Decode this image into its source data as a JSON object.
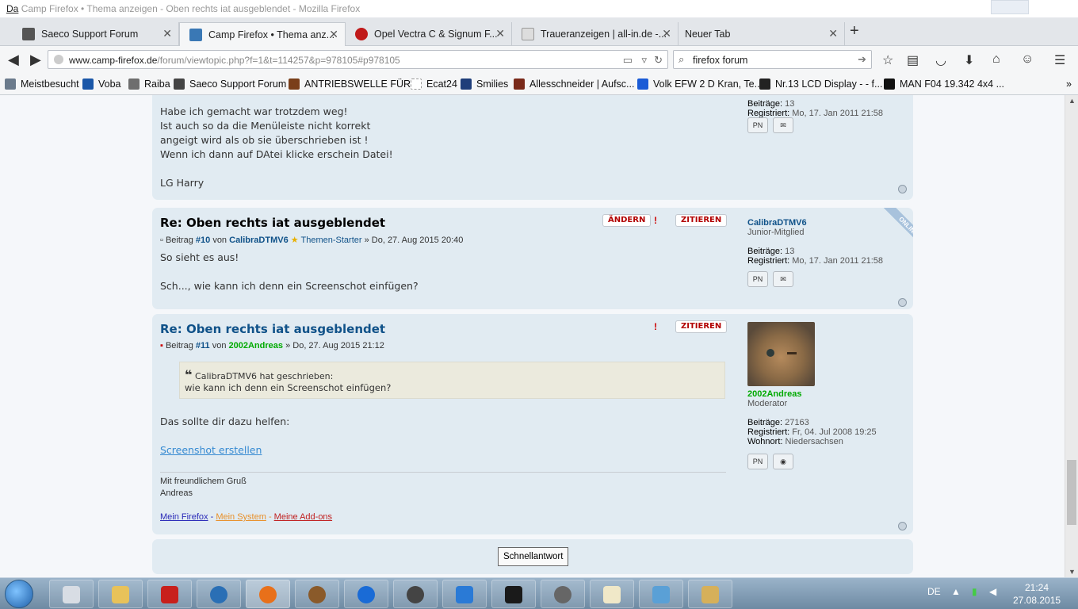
{
  "window": {
    "title_prefix": "Da",
    "title": "Camp Firefox • Thema anzeigen - Oben rechts iat ausgeblendet - Mozilla Firefox"
  },
  "tabs": [
    {
      "label": "Saeco Support Forum",
      "icon": "saeco-icon"
    },
    {
      "label": "Camp Firefox • Thema anz...",
      "icon": "camp-firefox-icon"
    },
    {
      "label": "Opel Vectra C & Signum F...",
      "icon": "opel-icon"
    },
    {
      "label": "Traueranzeigen | all-in.de -...",
      "icon": "allin-icon"
    },
    {
      "label": "Neuer Tab",
      "icon": ""
    }
  ],
  "newtab_label": "+",
  "nav": {
    "url_domain": "www.camp-firefox.de",
    "url_path": "/forum/viewtopic.php?f=1&t=114257&p=978105#p978105",
    "search_query": "firefox forum"
  },
  "bookmarks": [
    {
      "label": "Meistbesucht",
      "color": "#6b7b8c"
    },
    {
      "label": "Voba",
      "color": "#1a57a8"
    },
    {
      "label": "Raiba",
      "color": "#6e6e6e"
    },
    {
      "label": "Saeco Support Forum",
      "color": "#444"
    },
    {
      "label": "ANTRIEBSWELLE FÜR ...",
      "color": "#7a3f1a"
    },
    {
      "label": "Ecat24",
      "color": "#bbb"
    },
    {
      "label": "Smilies",
      "color": "#1f3e7a"
    },
    {
      "label": "Allesschneider | Aufsc...",
      "color": "#7a2a1a"
    },
    {
      "label": "Volk EFW 2 D Kran, Te...",
      "color": "#1a5bd6"
    },
    {
      "label": "Nr.13 LCD Display - - f...",
      "color": "#222"
    },
    {
      "label": "MAN F04 19.342 4x4 ...",
      "color": "#111"
    }
  ],
  "bookmarks_more": "»",
  "posts": [
    {
      "partial": true,
      "lines": [
        "Habe ich gemacht war trotzdem weg!",
        "Ist auch so da die Menüleiste nicht korrekt",
        "angeigt wird als ob sie überschrieben ist !",
        "Wenn ich dann auf DAtei klicke erschein Datei!",
        "",
        "LG Harry"
      ],
      "profile": {
        "beitraege_label": "Beiträge:",
        "beitraege": "13",
        "registriert_label": "Registriert:",
        "registriert": "Mo, 17. Jan 2011 21:58"
      }
    },
    {
      "title": "Re: Oben rechts iat ausgeblendet",
      "post_no": "#10",
      "author": "CalibraDTMV6",
      "starter": "Themen-Starter",
      "date": "» Do, 27. Aug 2015 20:40",
      "beitrag_label": "Beitrag",
      "von_label": "von",
      "lines": [
        "So sieht es aus!",
        "",
        "Sch..., wie kann ich denn ein Screenschot einfügen?"
      ],
      "buttons": {
        "edit": "ÄNDERN",
        "quote": "ZITIEREN"
      },
      "online": "ONLINE",
      "profile": {
        "name": "CalibraDTMV6",
        "rank": "Junior-Mitglied",
        "beitraege_label": "Beiträge:",
        "beitraege": "13",
        "registriert_label": "Registriert:",
        "registriert": "Mo, 17. Jan 2011 21:58"
      }
    },
    {
      "title": "Re: Oben rechts iat ausgeblendet",
      "post_no": "#11",
      "author": "2002Andreas",
      "date": "» Do, 27. Aug 2015 21:12",
      "beitrag_label": "Beitrag",
      "von_label": "von",
      "quote_author": "CalibraDTMV6 hat geschrieben:",
      "quote_text": "wie kann ich denn ein Screenschot einfügen?",
      "text": "Das sollte dir dazu helfen:",
      "link": "Screenshot erstellen",
      "sig_line1": "Mit freundlichem Gruß",
      "sig_line2": "Andreas",
      "sig_links": [
        "Mein Firefox",
        "Mein System",
        "Meine Add-ons"
      ],
      "sig_sep": " - ",
      "buttons": {
        "quote": "ZITIEREN"
      },
      "profile": {
        "name": "2002Andreas",
        "rank": "Moderator",
        "beitraege_label": "Beiträge:",
        "beitraege": "27163",
        "registriert_label": "Registriert:",
        "registriert": "Fr, 04. Jul 2008 19:25",
        "wohnort_label": "Wohnort:",
        "wohnort": "Niedersachsen"
      }
    }
  ],
  "quick_reply": "Schnellantwort",
  "taskbar": {
    "lang": "DE",
    "time": "21:24",
    "date": "27.08.2015"
  },
  "colors": {
    "post_bg": "#e1ebf2",
    "link": "#105289",
    "moderator": "#00aa00",
    "action": "#b20000"
  }
}
